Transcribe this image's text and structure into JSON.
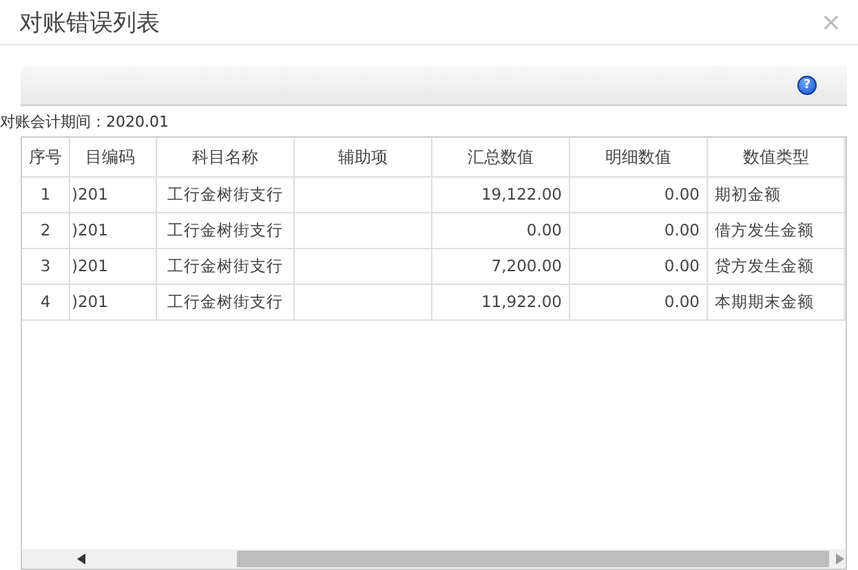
{
  "window": {
    "title": "对账错误列表",
    "close": "×"
  },
  "toolbar": {
    "help": "?"
  },
  "period_label": "对账会计期间：2020.01",
  "table": {
    "columns": [
      "序号",
      "目编码",
      "科目名称",
      "辅助项",
      "汇总数值",
      "明细数值",
      "数值类型"
    ],
    "rows": [
      {
        "cells": [
          "1",
          ")201",
          "工行金树街支行",
          "",
          "19,122.00",
          "0.00",
          "期初金额"
        ]
      },
      {
        "cells": [
          "2",
          ")201",
          "工行金树街支行",
          "",
          "0.00",
          "0.00",
          "借方发生金额"
        ]
      },
      {
        "cells": [
          "3",
          ")201",
          "工行金树街支行",
          "",
          "7,200.00",
          "0.00",
          "贷方发生金额"
        ]
      },
      {
        "cells": [
          "4",
          ")201",
          "工行金树街支行",
          "",
          "11,922.00",
          "0.00",
          "本期期末金额"
        ]
      }
    ]
  }
}
